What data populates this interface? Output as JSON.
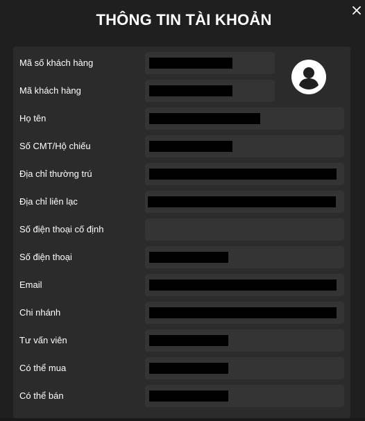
{
  "modal": {
    "title": "THÔNG TIN TÀI KHOẢN",
    "close_icon": "close-icon",
    "avatar_icon": "user-avatar-icon"
  },
  "fields": [
    {
      "label": "Mã số khách hàng"
    },
    {
      "label": "Mã khách hàng"
    },
    {
      "label": "Họ tên"
    },
    {
      "label": "Số CMT/Hộ chiếu"
    },
    {
      "label": "Địa chỉ thường trú"
    },
    {
      "label": "Địa chỉ liên lạc"
    },
    {
      "label": "Số điện thoại cố định"
    },
    {
      "label": "Số điện thoại"
    },
    {
      "label": "Email"
    },
    {
      "label": "Chi nhánh"
    },
    {
      "label": "Tư vấn viên"
    },
    {
      "label": "Có thể mua"
    },
    {
      "label": "Có thể bán"
    }
  ],
  "colors": {
    "background": "#1f1f1f",
    "panel": "#2b2b2b",
    "field": "#343434",
    "text": "#ffffff",
    "redaction": "#000000"
  }
}
